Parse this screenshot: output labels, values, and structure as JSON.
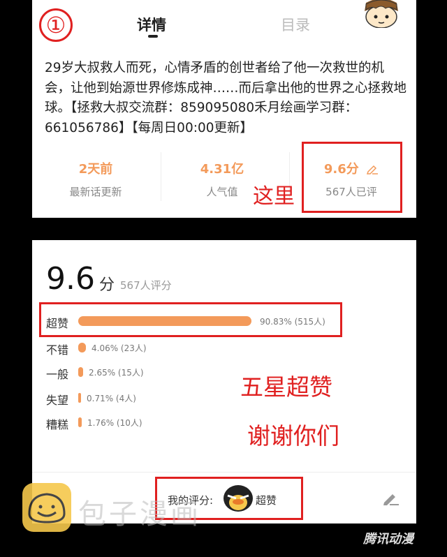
{
  "top": {
    "marker": "①",
    "tabs": {
      "details": "详情",
      "catalog": "目录"
    },
    "description": "29岁大叔救人而死，心情矛盾的创世者给了他一次救世的机会，让他到始源世界修炼成神……而后拿出他的世界之心拯救地球。【拯救大叔交流群：859095080禾月绘画学习群：661056786】【每周日00:00更新】",
    "stats": {
      "latest": {
        "value": "2天前",
        "label": "最新话更新"
      },
      "popularity": {
        "value": "4.31亿",
        "label": "人气值"
      },
      "rating": {
        "value": "9.6分",
        "label": "567人已评"
      }
    },
    "annotation": "这里"
  },
  "bottom": {
    "score": "9.6",
    "score_unit": "分",
    "score_count": "567人评分",
    "ratings": [
      {
        "label": "超赞",
        "fraction": 0.9083,
        "text": "90.83% (515人)"
      },
      {
        "label": "不错",
        "fraction": 0.0406,
        "text": "4.06% (23人)"
      },
      {
        "label": "一般",
        "fraction": 0.0265,
        "text": "2.65% (15人)"
      },
      {
        "label": "失望",
        "fraction": 0.0071,
        "text": "0.71% (4人)"
      },
      {
        "label": "糟糕",
        "fraction": 0.0176,
        "text": "1.76% (10人)"
      }
    ],
    "annotation1": "五星超赞",
    "annotation2": "谢谢你们",
    "my_rating_label": "我的评分:",
    "my_rating_value": "超赞"
  },
  "watermark": {
    "text": "包子漫画",
    "brand": "腾讯动漫"
  },
  "colors": {
    "accent": "#f39a5a",
    "annotation": "#e02020"
  }
}
